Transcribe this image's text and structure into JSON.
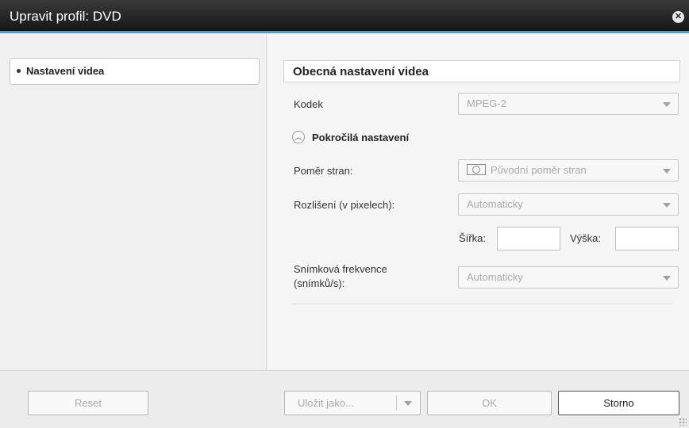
{
  "window": {
    "title": "Upravit profil: DVD",
    "close_icon": "close-icon",
    "accent_color": "#3aa5d8"
  },
  "sidebar": {
    "items": [
      {
        "label": "Nastavení videa",
        "selected": true
      }
    ]
  },
  "main": {
    "section_title": "Obecná nastavení videa",
    "codec": {
      "label": "Kodek",
      "value": "MPEG-2"
    },
    "advanced": {
      "label": "Pokročilá nastavení",
      "toggle_icon": "chevron-up-icon"
    },
    "aspect": {
      "label": "Poměr stran:",
      "value": "Původní poměr stran",
      "icon": "aspect-ratio-icon"
    },
    "resolution": {
      "label": "Rozlišení (v pixelech):",
      "value": "Automaticky"
    },
    "width": {
      "label": "Šířka:",
      "value": ""
    },
    "height": {
      "label": "Výška:",
      "value": ""
    },
    "framerate": {
      "label_line1": "Snímková frekvence",
      "label_line2": "(snímků/s):",
      "value": "Automaticky"
    }
  },
  "footer": {
    "reset": "Reset",
    "save_as": "Uložit jako...",
    "ok": "OK",
    "cancel": "Storno"
  }
}
